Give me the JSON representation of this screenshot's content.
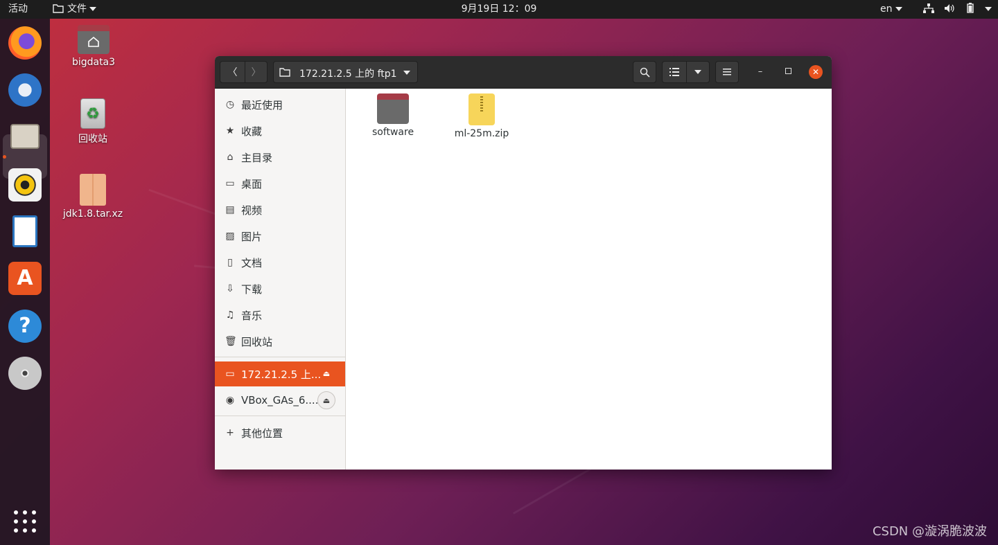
{
  "topbar": {
    "activities": "活动",
    "app_menu": "文件",
    "clock": "9月19日  12：09",
    "lang": "en"
  },
  "desktop": {
    "icons": [
      {
        "label": "bigdata3",
        "icon": "home-folder-icon"
      },
      {
        "label": "回收站",
        "icon": "trash-icon"
      },
      {
        "label": "jdk1.8.tar.xz",
        "icon": "archive-icon"
      }
    ]
  },
  "dock": {
    "apps": [
      "firefox-icon",
      "thunderbird-icon",
      "files-icon",
      "rhythmbox-icon",
      "writer-icon",
      "software-center-icon",
      "help-icon",
      "dvd-icon"
    ]
  },
  "window": {
    "path": "172.21.2.5 上的 ftp1",
    "sidebar": {
      "places": [
        {
          "label": "最近使用",
          "icon": "recent-icon"
        },
        {
          "label": "收藏",
          "icon": "star-icon"
        },
        {
          "label": "主目录",
          "icon": "home-icon"
        },
        {
          "label": "桌面",
          "icon": "desktop-icon"
        },
        {
          "label": "视频",
          "icon": "video-icon"
        },
        {
          "label": "图片",
          "icon": "picture-icon"
        },
        {
          "label": "文档",
          "icon": "document-icon"
        },
        {
          "label": "下载",
          "icon": "download-icon"
        },
        {
          "label": "音乐",
          "icon": "music-icon"
        },
        {
          "label": "回收站",
          "icon": "trash-icon"
        }
      ],
      "mounts": [
        {
          "label": "172.21.2.5 上...",
          "icon": "network-folder-icon",
          "active": true
        },
        {
          "label": "VBox_GAs_6....",
          "icon": "disc-icon",
          "active": false
        }
      ],
      "other": "其他位置"
    },
    "files": [
      {
        "name": "software",
        "type": "folder"
      },
      {
        "name": "ml-25m.zip",
        "type": "zip"
      }
    ]
  },
  "watermark": "CSDN @漩涡脆波波",
  "colors": {
    "accent": "#e95420",
    "headerbar": "#2c2c2c",
    "topbar": "#1d1d1d"
  }
}
